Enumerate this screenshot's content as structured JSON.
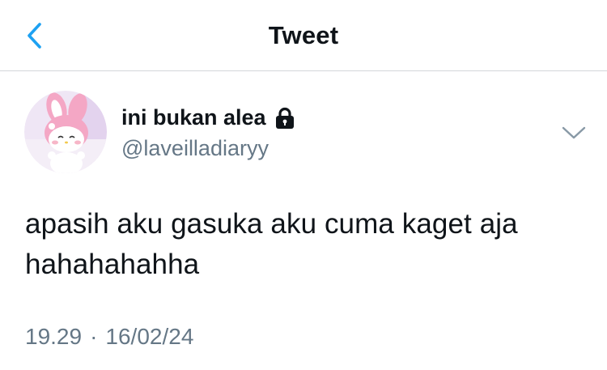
{
  "header": {
    "title": "Tweet",
    "back_icon": "chevron-left-icon",
    "accent_color": "#1da1f2"
  },
  "tweet": {
    "display_name": "ini bukan alea",
    "protected_icon": "lock-icon",
    "handle": "@laveilladiaryy",
    "more_icon": "chevron-down-icon",
    "text_line_1": "apasih aku gasuka aku cuma kaget aja",
    "text_line_2": "hahahahahha",
    "time": "19.29",
    "separator": "·",
    "date": "16/02/24"
  }
}
